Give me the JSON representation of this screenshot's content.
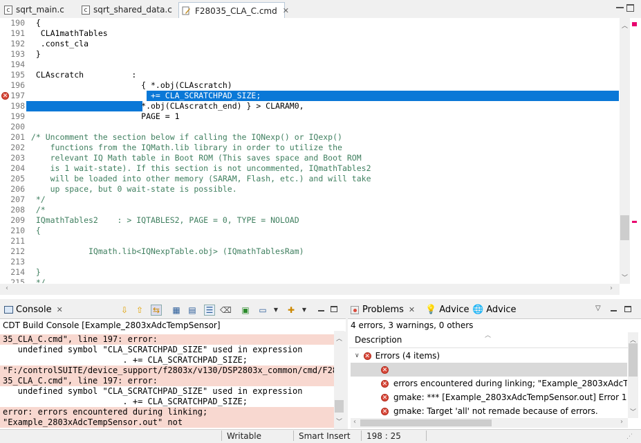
{
  "editor_tabs": [
    {
      "label": "sqrt_main.c",
      "icon": "c-file-icon",
      "active": false
    },
    {
      "label": "sqrt_shared_data.c",
      "icon": "c-file-icon",
      "active": false
    },
    {
      "label": "F28035_CLA_C.cmd",
      "icon": "cmd-file-icon",
      "active": true
    }
  ],
  "editor": {
    "lines": [
      {
        "num": "190",
        "text": "  {"
      },
      {
        "num": "191",
        "text": "   CLA1mathTables"
      },
      {
        "num": "192",
        "text": "   .const_cla"
      },
      {
        "num": "193",
        "text": "  }"
      },
      {
        "num": "194",
        "text": ""
      },
      {
        "num": "195",
        "text": "  CLAscratch          :"
      },
      {
        "num": "196",
        "text": "                        { *.obj(CLAscratch)"
      },
      {
        "num": "197",
        "text": "                        . += CLA_SCRATCHPAD_SIZE;"
      },
      {
        "num": "198",
        "text": "                        *.obj(CLAscratch_end) } > CLARAM0,"
      },
      {
        "num": "199",
        "text": "                        PAGE = 1"
      },
      {
        "num": "200",
        "text": ""
      },
      {
        "num": "201",
        "text": " /* Uncomment the section below if calling the IQNexp() or IQexp()"
      },
      {
        "num": "202",
        "text": "     functions from the IQMath.lib library in order to utilize the"
      },
      {
        "num": "203",
        "text": "     relevant IQ Math table in Boot ROM (This saves space and Boot ROM"
      },
      {
        "num": "204",
        "text": "     is 1 wait-state). If this section is not uncommented, IQmathTables2"
      },
      {
        "num": "205",
        "text": "     will be loaded into other memory (SARAM, Flash, etc.) and will take"
      },
      {
        "num": "206",
        "text": "     up space, but 0 wait-state is possible."
      },
      {
        "num": "207",
        "text": "  */"
      },
      {
        "num": "208",
        "text": "  /*"
      },
      {
        "num": "209",
        "text": "  IQmathTables2    : > IQTABLES2, PAGE = 0, TYPE = NOLOAD"
      },
      {
        "num": "210",
        "text": "  {"
      },
      {
        "num": "211",
        "text": ""
      },
      {
        "num": "212",
        "text": "             IQmath.lib<IQNexpTable.obj> (IQmathTablesRam)"
      },
      {
        "num": "213",
        "text": ""
      },
      {
        "num": "214",
        "text": "  }"
      },
      {
        "num": "215",
        "text": "  */"
      }
    ]
  },
  "console": {
    "tab_label": "Console",
    "title": "CDT Build Console [Example_2803xAdcTempSensor]",
    "lines": [
      {
        "text": "35_CLA_C.cmd\", line 197: error:",
        "error": true
      },
      {
        "text": "   undefined symbol \"CLA_SCRATCHPAD_SIZE\" used in expression",
        "error": false
      },
      {
        "text": "                        . += CLA_SCRATCHPAD_SIZE;",
        "error": false
      },
      {
        "text": "\"F:/controlSUITE/device_support/f2803x/v130/DSP2803x_common/cmd/F280",
        "error": true
      },
      {
        "text": "35_CLA_C.cmd\", line 197: error:",
        "error": true
      },
      {
        "text": "   undefined symbol \"CLA_SCRATCHPAD_SIZE\" used in expression",
        "error": false
      },
      {
        "text": "                        . += CLA_SCRATCHPAD_SIZE;",
        "error": false
      },
      {
        "text": "error: errors encountered during linking;",
        "error": true
      },
      {
        "text": "\"Example_2803xAdcTempSensor.out\" not",
        "error": true
      }
    ]
  },
  "problems": {
    "tabs": [
      "Problems",
      "Advice",
      "Advice"
    ],
    "summary": "4 errors, 3 warnings, 0 others",
    "column_header": "Description",
    "group_label": "Errors (4 items)",
    "items": [
      {
        "text": ""
      },
      {
        "text": "errors encountered during linking; \"Example_2803xAdcTe"
      },
      {
        "text": "gmake: *** [Example_2803xAdcTempSensor.out] Error 1"
      },
      {
        "text": "gmake: Target 'all' not remade because of errors."
      }
    ]
  },
  "status_bar": {
    "mode": "Writable",
    "insert": "Smart Insert",
    "position": "198 : 25"
  },
  "colors": {
    "selection": "#0a78d7",
    "error_line_bg": "#f8d8d0",
    "comment": "#3f7f5f"
  }
}
